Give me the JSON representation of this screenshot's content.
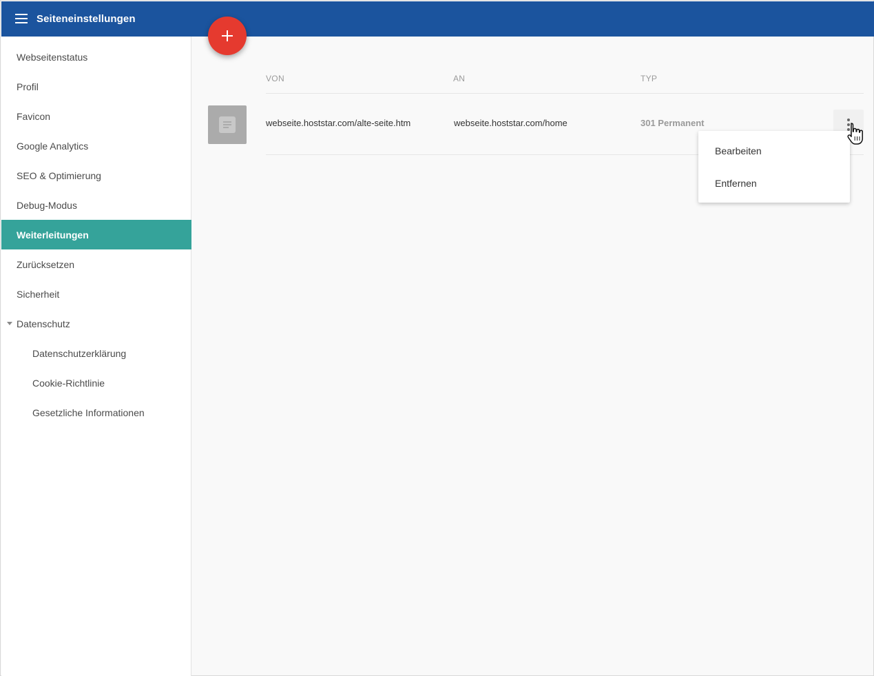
{
  "header": {
    "title": "Seiteneinstellungen",
    "menu_icon": "hamburger-icon"
  },
  "sidebar": {
    "items": [
      {
        "label": "Webseitenstatus"
      },
      {
        "label": "Profil"
      },
      {
        "label": "Favicon"
      },
      {
        "label": "Google Analytics"
      },
      {
        "label": "SEO & Optimierung"
      },
      {
        "label": "Debug-Modus"
      },
      {
        "label": "Weiterleitungen",
        "active": true
      },
      {
        "label": "Zurücksetzen"
      },
      {
        "label": "Sicherheit"
      },
      {
        "label": "Datenschutz",
        "expanded": true
      },
      {
        "label": "Datenschutzerklärung",
        "sub": true
      },
      {
        "label": "Cookie-Richtlinie",
        "sub": true
      },
      {
        "label": "Gesetzliche Informationen",
        "sub": true
      }
    ]
  },
  "fab": {
    "icon": "plus-icon",
    "color": "#e53a2f"
  },
  "table": {
    "columns": [
      "VON",
      "AN",
      "TYP"
    ],
    "rows": [
      {
        "icon": "document-icon",
        "von": "webseite.hoststar.com/alte-seite.htm",
        "an": "webseite.hoststar.com/home",
        "typ": "301 Permanent"
      }
    ]
  },
  "context_menu": {
    "items": [
      "Bearbeiten",
      "Entfernen"
    ]
  },
  "colors": {
    "header": "#1b549e",
    "active_item": "#35a39a",
    "fab": "#e53a2f"
  }
}
